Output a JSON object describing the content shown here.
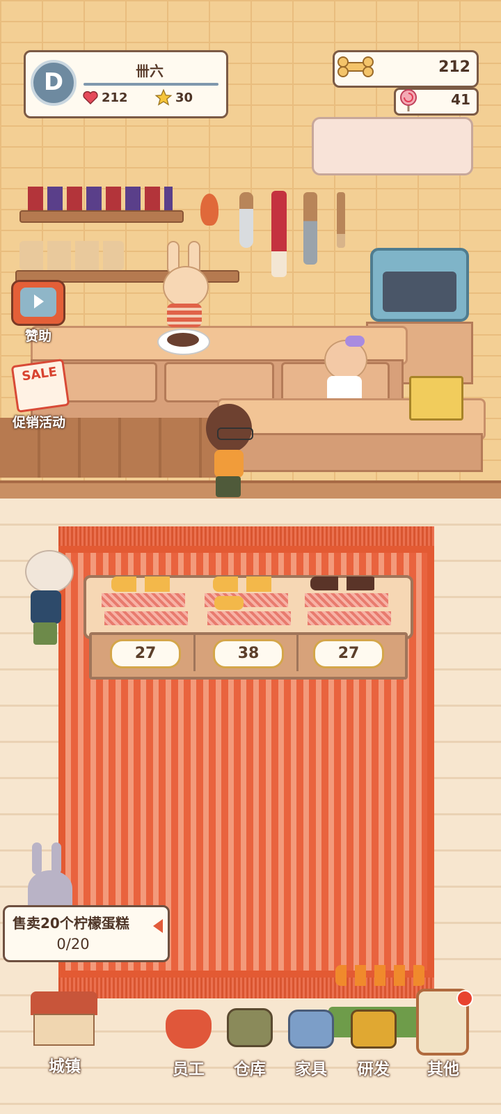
{
  "player": {
    "level_badge": "D",
    "name": "卌六",
    "hearts": "212",
    "stars": "30"
  },
  "currency": {
    "bones": "212",
    "candy": "41"
  },
  "side_buttons": {
    "sponsor": "赞助",
    "promotion": "促销活动",
    "sale_sign": "SALE"
  },
  "display_case": {
    "prices": [
      "27",
      "38",
      "27"
    ]
  },
  "quest": {
    "text": "售卖20个柠檬蛋糕",
    "progress": "0/20"
  },
  "nav": {
    "town": "城镇",
    "staff": "员工",
    "warehouse": "仓库",
    "furniture": "家具",
    "research": "研发",
    "other": "其他"
  },
  "colors": {
    "rug": "#e9633e",
    "wall": "#f3cf94",
    "frame": "#7b5a45"
  }
}
